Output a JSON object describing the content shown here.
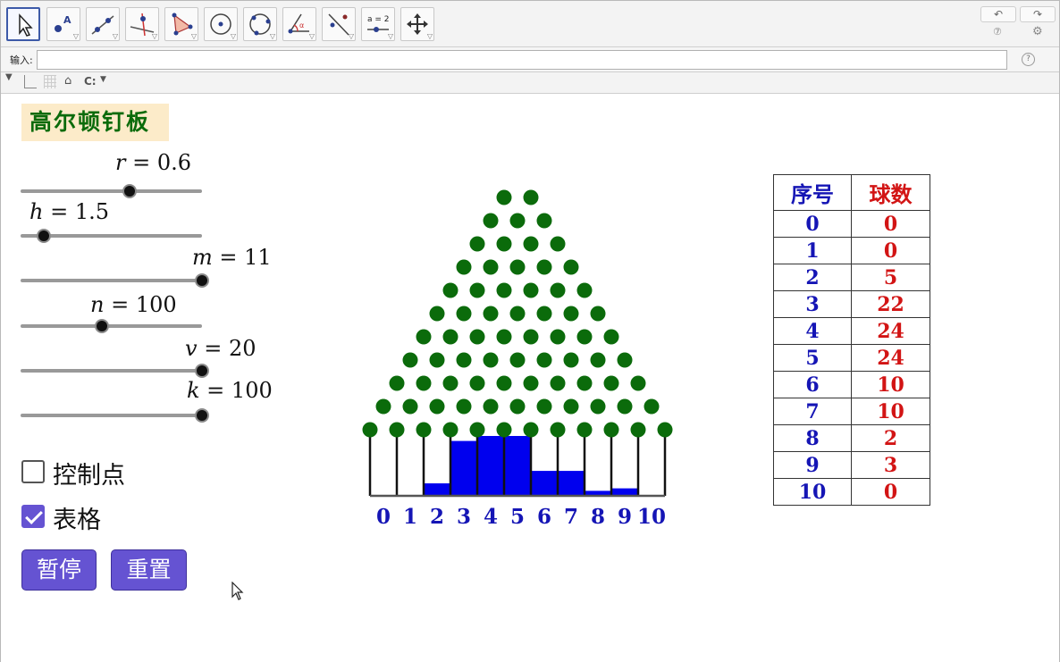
{
  "toolbar": {
    "tools": [
      {
        "name": "move-tool",
        "icon": "pointer-icon",
        "active": true
      },
      {
        "name": "point-tool",
        "icon": "point-icon",
        "active": false
      },
      {
        "name": "line-tool",
        "icon": "line-icon",
        "active": false
      },
      {
        "name": "perpendicular-tool",
        "icon": "perpendicular-icon",
        "active": false
      },
      {
        "name": "polygon-tool",
        "icon": "polygon-icon",
        "active": false
      },
      {
        "name": "circle-center-tool",
        "icon": "circle-center-icon",
        "active": false
      },
      {
        "name": "circle-three-points-tool",
        "icon": "circle-3pt-icon",
        "active": false
      },
      {
        "name": "angle-tool",
        "icon": "angle-icon",
        "active": false
      },
      {
        "name": "reflect-tool",
        "icon": "reflect-icon",
        "active": false
      },
      {
        "name": "slider-tool",
        "icon": "slider-icon",
        "active": false,
        "label": "a = 2"
      },
      {
        "name": "move-view-tool",
        "icon": "move-view-icon",
        "active": false
      }
    ],
    "undo_icon": "undo-icon",
    "redo_icon": "redo-icon",
    "help_icon": "help-icon",
    "settings_icon": "gear-icon"
  },
  "input_bar": {
    "label": "输入:",
    "value": "",
    "placeholder": ""
  },
  "view_bar": {
    "zoom_label": "C:"
  },
  "canvas": {
    "title": "高尔顿钉板",
    "sliders": [
      {
        "var": "r",
        "value": "0.6",
        "fraction": 0.6
      },
      {
        "var": "h",
        "value": "1.5",
        "fraction": 0.13
      },
      {
        "var": "m",
        "value": "11",
        "fraction": 1.0
      },
      {
        "var": "n",
        "value": "100",
        "fraction": 0.45
      },
      {
        "var": "v",
        "value": "20",
        "fraction": 1.0
      },
      {
        "var": "k",
        "value": "100",
        "fraction": 1.0
      }
    ],
    "checkboxes": [
      {
        "label": "控制点",
        "checked": false
      },
      {
        "label": "表格",
        "checked": true
      }
    ],
    "buttons": {
      "pause": "暂停",
      "reset": "重置"
    }
  },
  "board": {
    "peg_rows": 11,
    "peg_color": "#0b6b0b",
    "bar_color": "#0000ee",
    "bin_labels": [
      "0",
      "1",
      "2",
      "3",
      "4",
      "5",
      "6",
      "7",
      "8",
      "9",
      "10"
    ],
    "label_color": "#1515b5"
  },
  "table": {
    "headers": [
      "序号",
      "球数"
    ],
    "rows": [
      [
        "0",
        "0"
      ],
      [
        "1",
        "0"
      ],
      [
        "2",
        "5"
      ],
      [
        "3",
        "22"
      ],
      [
        "4",
        "24"
      ],
      [
        "5",
        "24"
      ],
      [
        "6",
        "10"
      ],
      [
        "7",
        "10"
      ],
      [
        "8",
        "2"
      ],
      [
        "9",
        "3"
      ],
      [
        "10",
        "0"
      ]
    ]
  },
  "chart_data": {
    "type": "bar",
    "categories": [
      "0",
      "1",
      "2",
      "3",
      "4",
      "5",
      "6",
      "7",
      "8",
      "9",
      "10"
    ],
    "values": [
      0,
      0,
      5,
      22,
      24,
      24,
      10,
      10,
      2,
      3,
      0
    ],
    "title": "",
    "xlabel": "",
    "ylabel": "",
    "ylim": [
      0,
      24
    ]
  }
}
